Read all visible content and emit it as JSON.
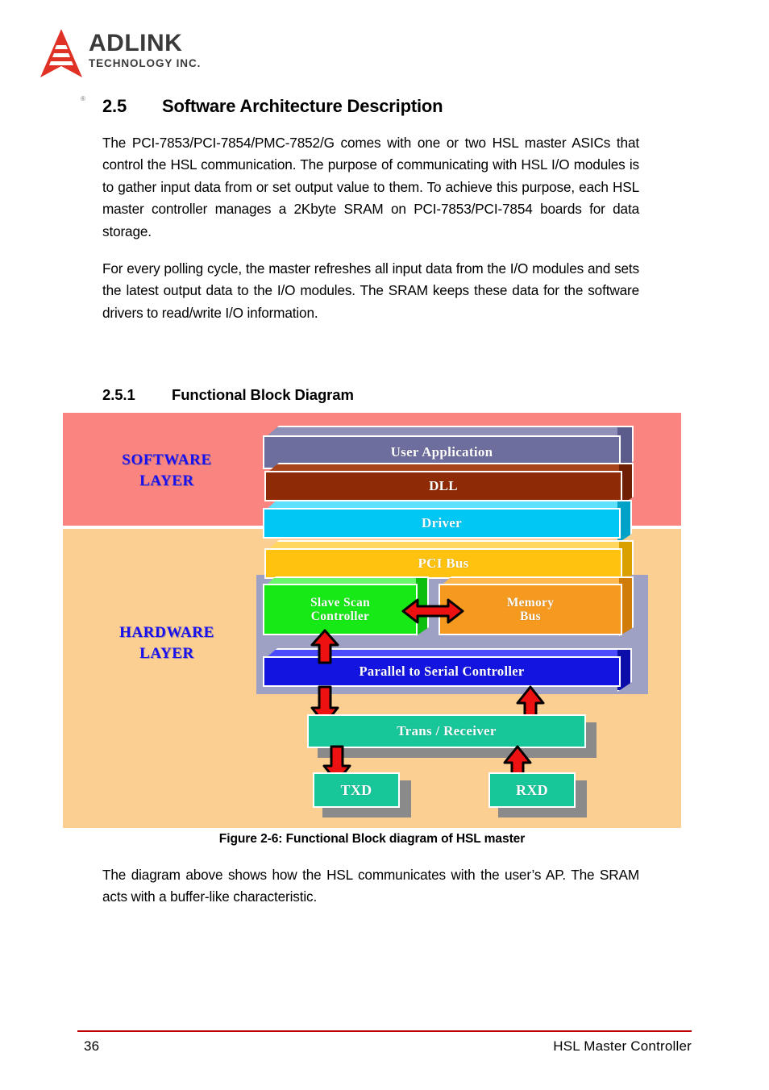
{
  "brand": {
    "name": "ADLINK",
    "tagline": "TECHNOLOGY INC.",
    "registered_mark": "®",
    "logo_color": "#e03127",
    "text_color": "#3a3a3a"
  },
  "section": {
    "number": "2.5",
    "title": "Software Architecture Description",
    "paragraphs": [
      "The PCI-7853/PCI-7854/PMC-7852/G comes with one or two HSL master ASICs that control the HSL communication. The purpose of communicating with HSL I/O modules is to gather input data from or set output value to them. To achieve this purpose, each HSL master controller manages a 2Kbyte SRAM on PCI-7853/PCI-7854 boards for data storage.",
      "For every polling cycle, the master refreshes all input data from the I/O modules and sets the latest output data to the I/O modules. The SRAM keeps these data for the software drivers to read/write I/O information."
    ]
  },
  "subsection": {
    "number": "2.5.1",
    "title": "Functional Block Diagram"
  },
  "figure": {
    "caption": "Figure 2-6: Functional Block diagram of HSL master",
    "layers": [
      {
        "id": "software",
        "label_line1": "SOFTWARE",
        "label_line2": "LAYER",
        "background": "#fa8580",
        "label_color": "#1a10ee"
      },
      {
        "id": "hardware",
        "label_line1": "HARDWARE",
        "label_line2": "LAYER",
        "background": "#fbcf92",
        "label_color": "#1a10ee"
      }
    ],
    "asic_container_color": "#9ea0c4",
    "blocks": [
      {
        "id": "user-application",
        "label": "User Application",
        "color": "#6d6d9e",
        "top_face": "#8f8fb8",
        "side_face": "#5b5b8c"
      },
      {
        "id": "dll",
        "label": "DLL",
        "color": "#8f2a06",
        "top_face": "#a8441c",
        "side_face": "#6e1f04"
      },
      {
        "id": "driver",
        "label": "Driver",
        "color": "#00c8f5",
        "top_face": "#5fe0ff",
        "side_face": "#00a2c8"
      },
      {
        "id": "pci-bus",
        "label": "PCI Bus",
        "color": "#ffc20e",
        "top_face": "#ffd75e",
        "side_face": "#d9a000"
      },
      {
        "id": "slave-scan-controller",
        "label": "Slave Scan Controller",
        "label_line1": "Slave Scan",
        "label_line2": "Controller",
        "color": "#16e916",
        "top_face": "#6bf76b",
        "side_face": "#0ebe0e"
      },
      {
        "id": "memory-bus",
        "label": "Memory Bus",
        "label_line1": "Memory",
        "label_line2": "Bus",
        "color": "#f59a1e",
        "top_face": "#ffb84d",
        "side_face": "#cf7d08"
      },
      {
        "id": "parallel-to-serial-controller",
        "label": "Parallel to Serial Controller",
        "color": "#1414e0",
        "top_face": "#4a4aff",
        "side_face": "#0d0daa"
      },
      {
        "id": "trans-receiver",
        "label": "Trans / Receiver",
        "color": "#17c79a",
        "shadow": "#8a8a8a"
      },
      {
        "id": "txd",
        "label": "TXD",
        "color": "#17c79a",
        "shadow": "#8a8a8a"
      },
      {
        "id": "rxd",
        "label": "RXD",
        "color": "#17c79a",
        "shadow": "#8a8a8a"
      }
    ],
    "arrows": [
      {
        "id": "scan-memory-arrow",
        "direction": "horizontal-bidirectional",
        "color": "#ee1111",
        "from": "slave-scan-controller",
        "to": "memory-bus"
      },
      {
        "id": "serial-to-scan-arrow",
        "direction": "up",
        "color": "#ee1111",
        "from": "parallel-to-serial-controller",
        "to": "slave-scan-controller"
      },
      {
        "id": "serial-to-trans-arrow",
        "direction": "down",
        "color": "#ee1111",
        "from": "parallel-to-serial-controller",
        "to": "trans-receiver"
      },
      {
        "id": "trans-to-serial-arrow",
        "direction": "up",
        "color": "#ee1111",
        "from": "trans-receiver",
        "to": "parallel-to-serial-controller"
      },
      {
        "id": "trans-to-txd-arrow",
        "direction": "down",
        "color": "#ee1111",
        "from": "trans-receiver",
        "to": "txd"
      },
      {
        "id": "rxd-to-trans-arrow",
        "direction": "up",
        "color": "#ee1111",
        "from": "rxd",
        "to": "trans-receiver"
      }
    ]
  },
  "closing_paragraph": "The diagram above shows how the HSL communicates with the user’s AP. The SRAM acts with a buffer-like characteristic.",
  "footer": {
    "page_number": "36",
    "title": "HSL Master Controller",
    "rule_color": "#c00000"
  }
}
